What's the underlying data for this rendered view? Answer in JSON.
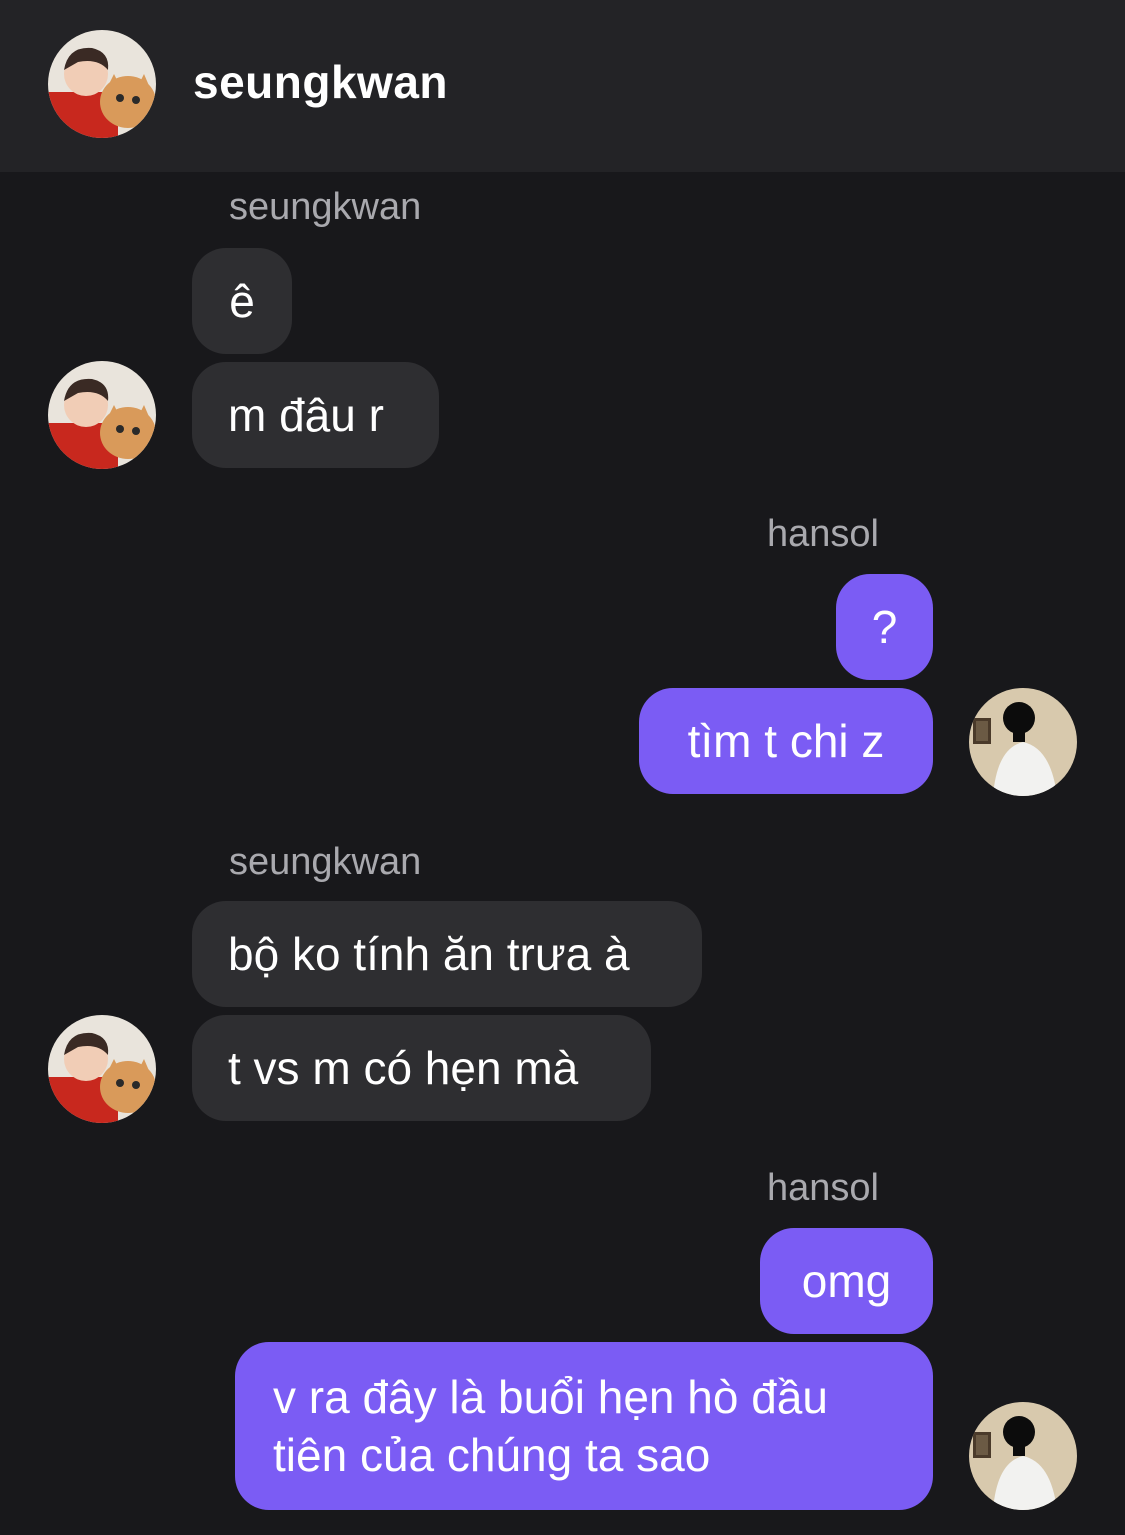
{
  "header": {
    "title": "seungkwan"
  },
  "messages": [
    {
      "sender": "seungkwan",
      "text": "ê"
    },
    {
      "text": "m đâu r"
    },
    {
      "sender": "hansol",
      "text": "?"
    },
    {
      "text": "tìm t chi z"
    },
    {
      "sender": "seungkwan",
      "text": "bộ ko tính ăn trưa à"
    },
    {
      "text": "t vs m có hẹn mà"
    },
    {
      "sender": "hansol",
      "text": "omg"
    },
    {
      "text": "v ra đây là buổi hẹn hò đầu tiên của chúng ta sao"
    }
  ],
  "colors": {
    "background": "#18181b",
    "header": "#232326",
    "incoming_bubble": "#2e2e31",
    "outgoing_bubble": "#7b5cf4",
    "sender_text": "#a9a9ae"
  }
}
